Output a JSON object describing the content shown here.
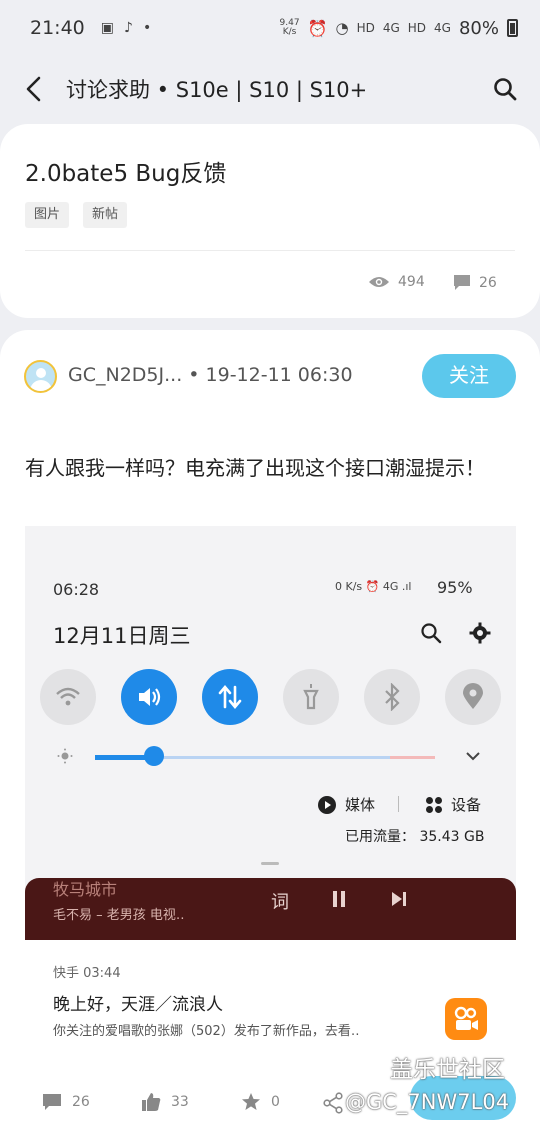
{
  "status_bar": {
    "time": "21:40",
    "net_speed": "9.47\nK/s",
    "hd1": "HD",
    "hd2": "HD",
    "sig1": "4G",
    "sig2": "4G",
    "battery": "80%"
  },
  "header": {
    "title": "讨论求助 • S10e | S10 | S10+"
  },
  "post": {
    "title": "2.0bate5 Bug反馈",
    "tags": [
      "图片",
      "新帖"
    ],
    "views": "494",
    "comments": "26"
  },
  "reply": {
    "author": "GC_N2D5J... • 19-12-11 06:30",
    "follow_label": "关注",
    "content": "有人跟我一样吗？电充满了出现这个接口潮湿提示！"
  },
  "embedded_screenshot": {
    "time": "06:28",
    "status": "0 K/s",
    "battery": "95%",
    "date": "12月11日周三",
    "media_label": "媒体",
    "device_label": "设备",
    "traffic": "已用流量： 35.43 GB",
    "music_top": "牧马城市",
    "music_sub": "毛不易 – 老男孩  电视‥",
    "lyric_label": "词",
    "notif_app": "快手  03:44",
    "notif_title": "晚上好，天涯／流浪人",
    "notif_body": "你关注的爱唱歌的张娜（502）发布了新作品，去看‥"
  },
  "bottom_bar": {
    "comments": "26",
    "likes": "33",
    "stars": "0"
  },
  "watermark": {
    "line1": "盖乐世社区",
    "line2": "@GC_7NW7L04"
  },
  "colors": {
    "accent": "#5cc8ec",
    "toggle_on": "#1f8ae8",
    "background": "#eeeff3"
  }
}
